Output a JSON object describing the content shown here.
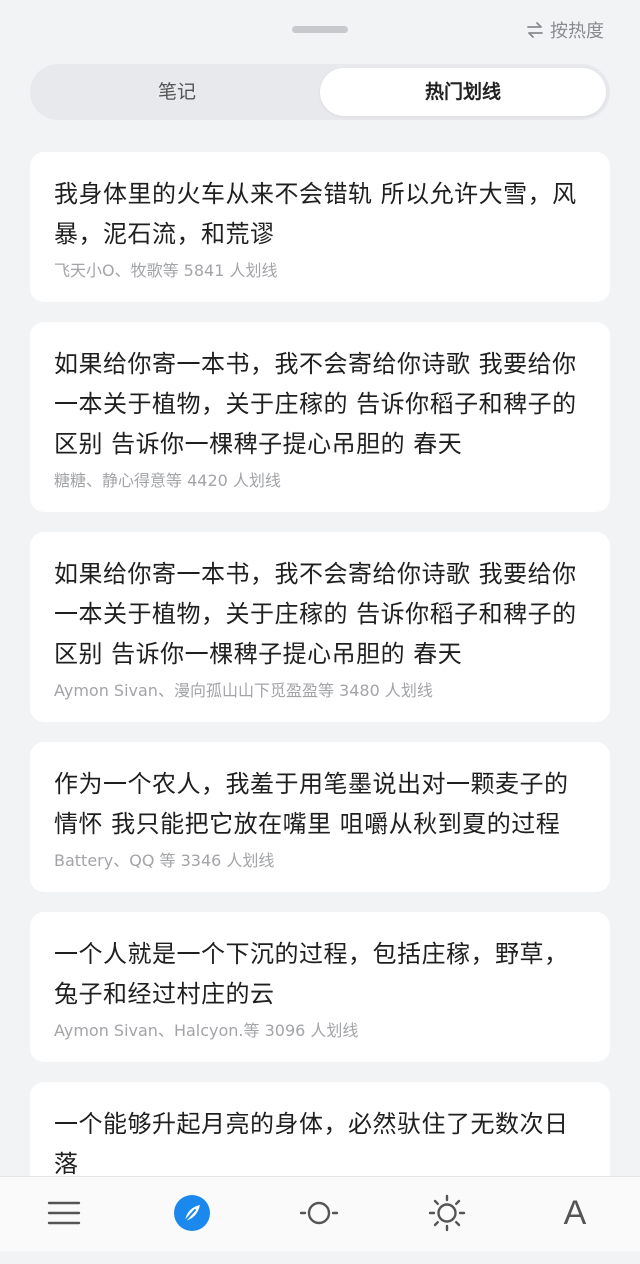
{
  "header": {
    "sort_label": "按热度",
    "tabs": [
      {
        "label": "笔记"
      },
      {
        "label": "热门划线"
      }
    ],
    "active_tab": "热门划线"
  },
  "highlights": [
    {
      "quote": "我身体里的火车从来不会错轨 所以允许大雪，风暴，泥石流，和荒谬",
      "meta": "飞天小O、牧歌等 5841 人划线"
    },
    {
      "quote": "如果给你寄一本书，我不会寄给你诗歌 我要给你一本关于植物，关于庄稼的 告诉你稻子和稗子的区别 告诉你一棵稗子提心吊胆的 春天",
      "meta": "糖糖、静心得意等 4420 人划线"
    },
    {
      "quote": "如果给你寄一本书，我不会寄给你诗歌 我要给你一本关于植物，关于庄稼的 告诉你稻子和稗子的区别 告诉你一棵稗子提心吊胆的 春天",
      "meta": "Aymon Sivan、漫向孤山山下觅盈盈等 3480 人划线"
    },
    {
      "quote": "作为一个农人，我羞于用笔墨说出对一颗麦子的情怀 我只能把它放在嘴里 咀嚼从秋到夏的过程",
      "meta": "Battery、QQ 等 3346 人划线"
    },
    {
      "quote": "一个人就是一个下沉的过程，包括庄稼，野草，兔子和经过村庄的云",
      "meta": "Aymon Sivan、Halcyon.等 3096 人划线"
    },
    {
      "quote": "一个能够升起月亮的身体，必然驮住了无数次日落",
      "meta": ""
    }
  ],
  "bottom_bar": {
    "font_label": "A",
    "icons": [
      "menu-icon",
      "compass-icon",
      "progress-icon",
      "brightness-icon",
      "font-icon"
    ],
    "accent": "#1b88ee"
  }
}
